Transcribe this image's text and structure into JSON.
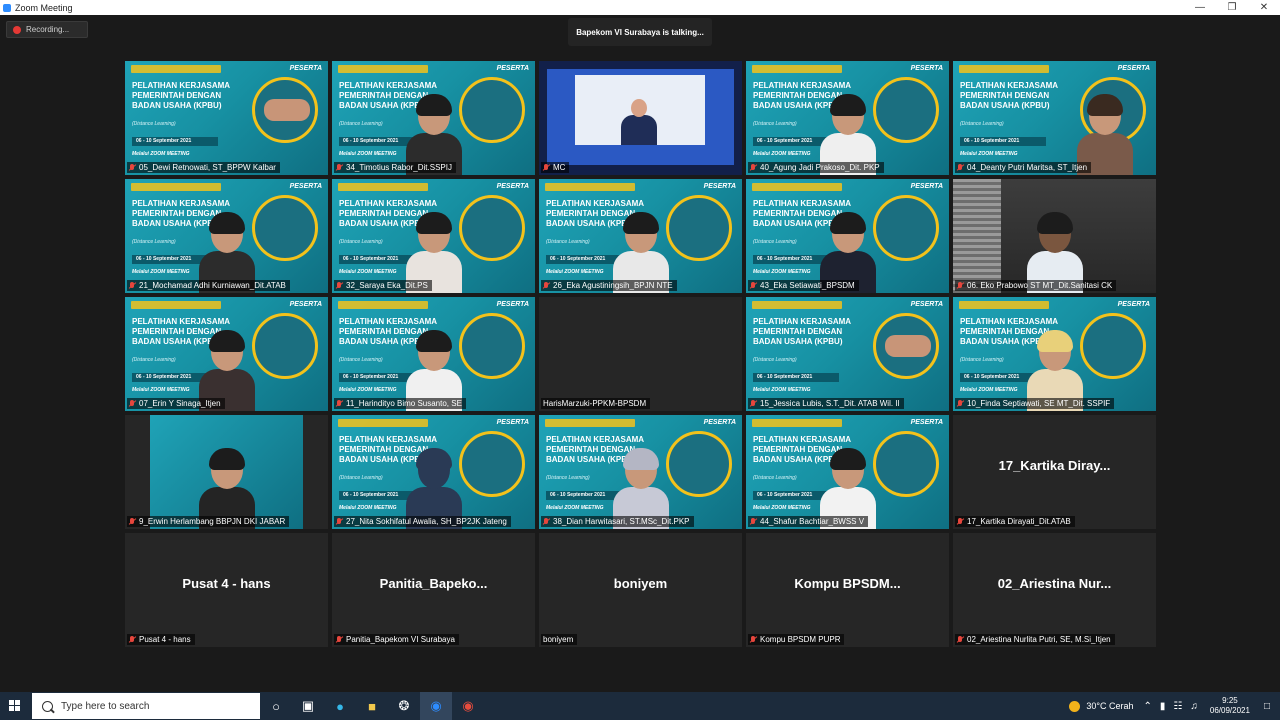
{
  "window": {
    "title": "Zoom Meeting",
    "controls": [
      "minimize",
      "maximize",
      "close"
    ]
  },
  "meeting": {
    "recording_label": "Recording...",
    "talking_label": "Bapekom VI Surabaya is talking..."
  },
  "slide": {
    "headline": "PELATIHAN KERJASAMA PEMERINTAH DENGAN BADAN USAHA (KPBU)",
    "subtitle": "(Distance Learning)",
    "date": "06 - 10 September 2021",
    "meeting": "Melalui ZOOM MEETING",
    "badge": "PESERTA"
  },
  "participants": [
    {
      "name": "05_Dewi Retnowati, ST_BPPW Kalbar",
      "muted": true,
      "video": true
    },
    {
      "name": "34_Timotius Rabor_Dit.SSPIJ",
      "muted": true,
      "video": true
    },
    {
      "name": "MC",
      "muted": true,
      "video": true
    },
    {
      "name": "40_Agung Jadi Prakoso_Dit. PKP",
      "muted": true,
      "video": true
    },
    {
      "name": "04_Deanty Putri Maritsa, ST_Itjen",
      "muted": true,
      "video": true
    },
    {
      "name": "21_Mochamad Adhi Kurniawan_Dit.ATAB",
      "muted": true,
      "video": true
    },
    {
      "name": "32_Saraya Eka_Dit.PS",
      "muted": true,
      "video": true
    },
    {
      "name": "26_Eka Agustiningsih_BPJN NTE",
      "muted": true,
      "video": true
    },
    {
      "name": "43_Eka Setiawati_BPSDM",
      "muted": true,
      "video": true
    },
    {
      "name": "06. Eko Prabowo ST MT_Dit.Sanitasi CK",
      "muted": true,
      "video": true
    },
    {
      "name": "07_Erin Y Sinaga_Itjen",
      "muted": true,
      "video": true
    },
    {
      "name": "11_Harindityo Bimo Susanto, SE",
      "muted": true,
      "video": true
    },
    {
      "name": "HarisMarzuki-PPKM-BPSDM",
      "muted": false,
      "video": false,
      "display": ""
    },
    {
      "name": "15_Jessica Lubis, S.T._Dit. ATAB Wil. II",
      "muted": true,
      "video": true
    },
    {
      "name": "10_Finda Septiawati, SE MT_Dit. SSPIF",
      "muted": true,
      "video": true
    },
    {
      "name": "9_Erwin Herlambang BBPJN DKI JABAR",
      "muted": true,
      "video": true
    },
    {
      "name": "27_Nita Sokhifatul Awalia, SH_BP2JK Jateng",
      "muted": true,
      "video": true
    },
    {
      "name": "38_Dian Harwitasari, ST.MSc_Dit.PKP",
      "muted": true,
      "video": true
    },
    {
      "name": "44_Shafur Bachtiar_BWSS V",
      "muted": true,
      "video": true
    },
    {
      "name": "17_Kartika Dirayati_Dit.ATAB",
      "muted": true,
      "video": false,
      "display": "17_Kartika Diray..."
    },
    {
      "name": "Pusat 4 - hans",
      "muted": true,
      "video": false,
      "display": "Pusat 4 - hans"
    },
    {
      "name": "Panitia_Bapekom VI Surabaya",
      "muted": true,
      "video": false,
      "display": "Panitia_Bapeko..."
    },
    {
      "name": "boniyem",
      "muted": false,
      "video": false,
      "display": "boniyem"
    },
    {
      "name": "Kompu BPSDM PUPR",
      "muted": true,
      "video": false,
      "display": "Kompu BPSDM..."
    },
    {
      "name": "02_Ariestina Nurlita Putri, SE, M.Si_Itjen",
      "muted": true,
      "video": false,
      "display": "02_Ariestina Nur..."
    }
  ],
  "taskbar": {
    "search_placeholder": "Type here to search",
    "weather": "30°C Cerah",
    "time": "9:25",
    "date": "06/09/2021"
  }
}
